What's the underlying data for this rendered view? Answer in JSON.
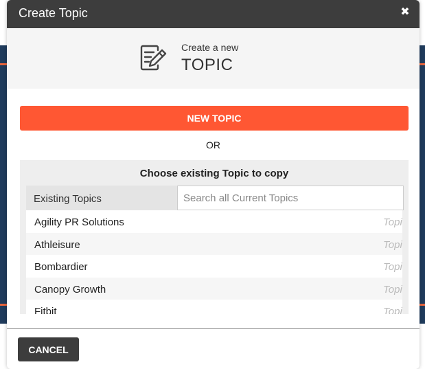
{
  "modal": {
    "title": "Create Topic",
    "close_glyph": "✖"
  },
  "header": {
    "icon": "edit-document-icon",
    "subtitle": "Create a new",
    "main": "TOPIC"
  },
  "actions": {
    "new_topic_label": "NEW TOPIC",
    "or_label": "OR",
    "cancel_label": "CANCEL"
  },
  "copy_panel": {
    "title": "Choose existing Topic to copy",
    "column_header": "Existing Topics",
    "search_placeholder": "Search all Current Topics",
    "search_value": "",
    "topics": [
      {
        "name": "Agility PR Solutions",
        "tag": "Topic"
      },
      {
        "name": "Athleisure",
        "tag": "Topic"
      },
      {
        "name": "Bombardier",
        "tag": "Topic"
      },
      {
        "name": "Canopy Growth",
        "tag": "Topic"
      },
      {
        "name": "Fitbit",
        "tag": "Topic"
      }
    ]
  },
  "colors": {
    "accent": "#ff5733",
    "titlebar": "#3d3d3d",
    "background_navy": "#1f3b5c",
    "background_orange": "#e8643c"
  }
}
